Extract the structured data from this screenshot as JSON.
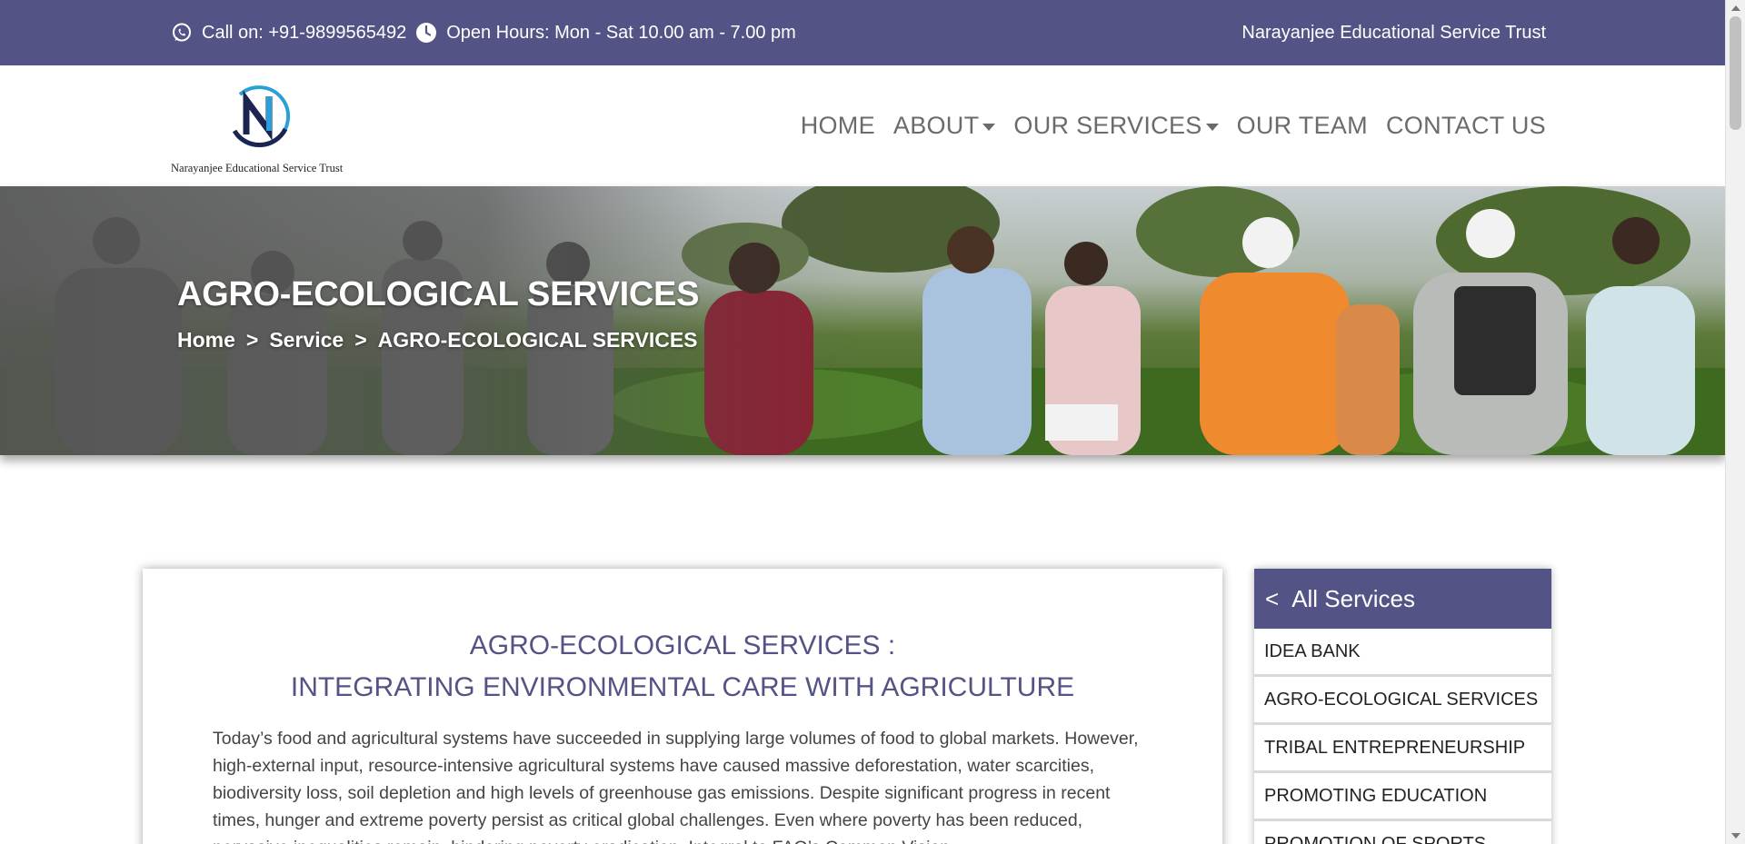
{
  "topbar": {
    "phone_icon": "whatsapp-icon",
    "phone": "Call on: +91-9899565492",
    "hours_icon": "clock-icon",
    "hours": "Open Hours: Mon - Sat 10.00 am - 7.00 pm",
    "org_name": "Narayanjee Educational Service Trust"
  },
  "header": {
    "logo_letter": "N",
    "logo_caption": "Narayanjee Educational Service Trust",
    "nav": {
      "home": "HOME",
      "about": "ABOUT",
      "services": "OUR SERVICES",
      "team": "OUR TEAM",
      "contact": "CONTACT US"
    }
  },
  "hero": {
    "title": "AGRO-ECOLOGICAL SERVICES",
    "breadcrumb": {
      "home": "Home",
      "sep": ">",
      "service": "Service",
      "current": "AGRO-ECOLOGICAL SERVICES"
    }
  },
  "content": {
    "heading_line1": "AGRO-ECOLOGICAL SERVICES :",
    "heading_line2": "INTEGRATING ENVIRONMENTAL CARE WITH AGRICULTURE",
    "paragraph": "Today’s food and agricultural systems have succeeded in supplying large volumes of food to global markets. However, high-external input, resource-intensive agricultural systems have caused massive deforestation, water scarcities, biodiversity loss, soil depletion and high levels of greenhouse gas emissions. Despite significant progress in recent times, hunger and extreme poverty persist as critical global challenges. Even where poverty has been reduced, pervasive inequalities remain, hindering poverty eradication. Integral to FAO’s Common Vision"
  },
  "sidebar": {
    "back": "<",
    "title": "All Services",
    "items": [
      "IDEA BANK",
      "AGRO-ECOLOGICAL SERVICES",
      "TRIBAL ENTREPRENEURSHIP",
      "PROMOTING EDUCATION",
      "PROMOTION OF SPORTS"
    ]
  },
  "colors": {
    "brand": "#545386",
    "nav_text": "#6b6b6b",
    "logo_blue": "#2aa0d8",
    "logo_navy": "#1c2550"
  }
}
